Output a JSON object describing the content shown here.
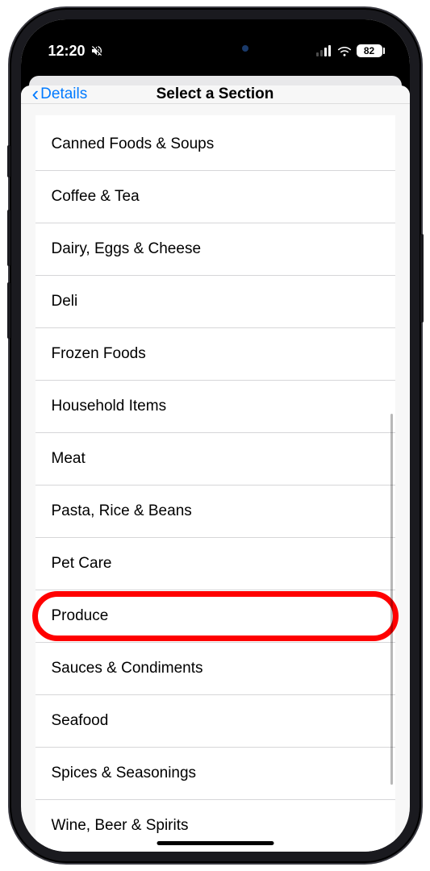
{
  "status": {
    "time": "12:20",
    "silent_icon": "🔕",
    "battery": "82"
  },
  "nav": {
    "back_label": "Details",
    "title": "Select a Section"
  },
  "sections": [
    "Canned Foods & Soups",
    "Coffee & Tea",
    "Dairy, Eggs & Cheese",
    "Deli",
    "Frozen Foods",
    "Household Items",
    "Meat",
    "Pasta, Rice & Beans",
    "Pet Care",
    "Produce",
    "Sauces & Condiments",
    "Seafood",
    "Spices & Seasonings",
    "Wine, Beer & Spirits"
  ],
  "highlighted_index": 9
}
